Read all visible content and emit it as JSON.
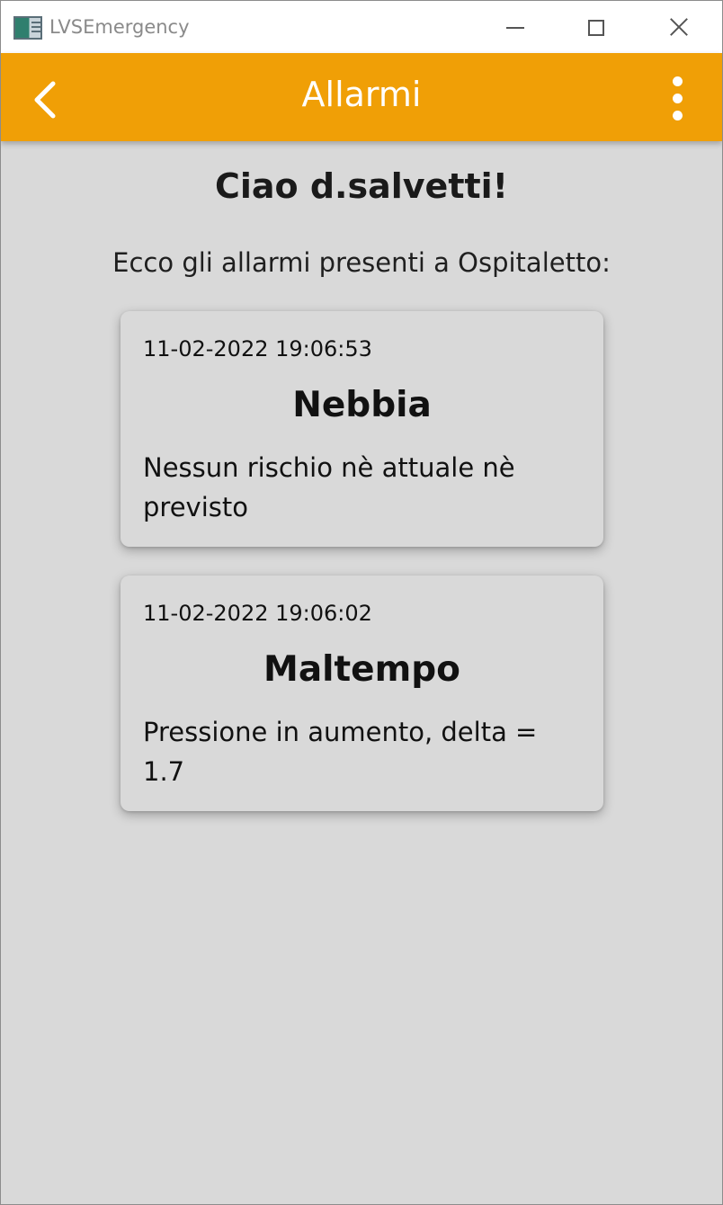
{
  "window": {
    "title": "LVSEmergency"
  },
  "appbar": {
    "title": "Allarmi",
    "color": "#f09f06"
  },
  "content": {
    "greeting": "Ciao d.salvetti!",
    "intro": "Ecco gli allarmi presenti a Ospitaletto:"
  },
  "alarms": [
    {
      "timestamp": "11-02-2022 19:06:53",
      "title": "Nebbia",
      "description": "Nessun rischio nè attuale nè previsto"
    },
    {
      "timestamp": "11-02-2022 19:06:02",
      "title": "Maltempo",
      "description": "Pressione in aumento, delta = 1.7"
    }
  ]
}
